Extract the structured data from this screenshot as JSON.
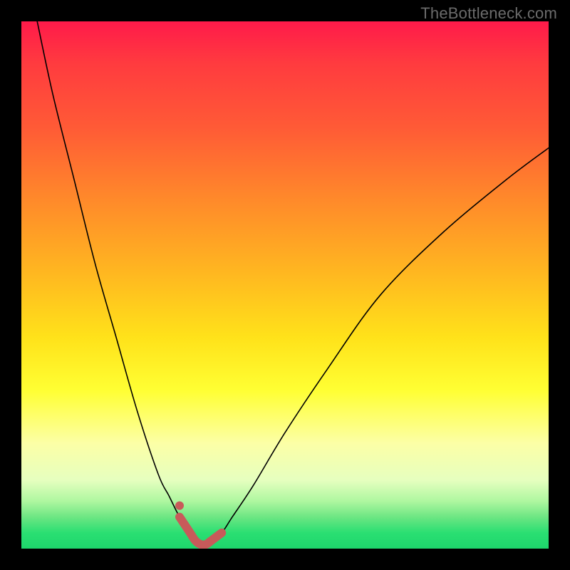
{
  "watermark": "TheBottleneck.com",
  "colors": {
    "page_bg": "#000000",
    "gradient_top": "#ff1a4a",
    "gradient_mid": "#ffe21a",
    "gradient_bottom": "#1ed66c",
    "curve_thin": "#000000",
    "curve_thick": "#c85a5a"
  },
  "chart_data": {
    "type": "line",
    "title": "",
    "xlabel": "",
    "ylabel": "",
    "xlim": [
      0,
      100
    ],
    "ylim": [
      0,
      100
    ],
    "grid": false,
    "series": [
      {
        "name": "bottleneck-curve",
        "x": [
          3,
          6,
          10,
          14,
          18,
          22,
          26,
          28,
          30,
          32,
          33,
          34,
          35,
          36,
          38,
          40,
          44,
          50,
          58,
          68,
          80,
          92,
          100
        ],
        "y": [
          100,
          86,
          70,
          54,
          40,
          26,
          14,
          10,
          6,
          3,
          1.5,
          0.8,
          0.8,
          1.5,
          3,
          6,
          12,
          22,
          34,
          48,
          60,
          70,
          76
        ]
      }
    ],
    "highlight_range_x": [
      30,
      38
    ],
    "highlight_dot_x": 30,
    "annotations": []
  }
}
